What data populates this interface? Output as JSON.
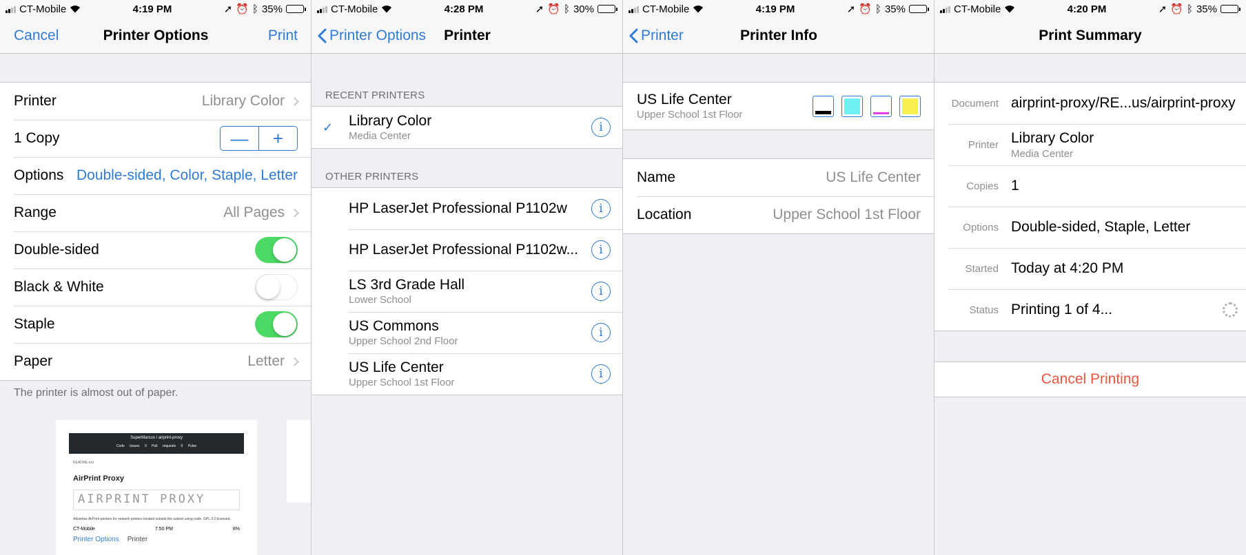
{
  "status_bars": [
    {
      "carrier": "CT-Mobile",
      "time": "4:19 PM",
      "battery": "35%",
      "battery_level": 0.35
    },
    {
      "carrier": "CT-Mobile",
      "time": "4:28 PM",
      "battery": "30%",
      "battery_level": 0.3
    },
    {
      "carrier": "CT-Mobile",
      "time": "4:19 PM",
      "battery": "35%",
      "battery_level": 0.35
    },
    {
      "carrier": "CT-Mobile",
      "time": "4:20 PM",
      "battery": "35%",
      "battery_level": 0.35
    }
  ],
  "screen1": {
    "nav": {
      "left": "Cancel",
      "title": "Printer Options",
      "right": "Print"
    },
    "rows": {
      "printer_label": "Printer",
      "printer_value": "Library Color",
      "copy_label": "1 Copy",
      "stepper_minus": "—",
      "stepper_plus": "+",
      "options_label": "Options",
      "options_value": "Double-sided, Color, Staple, Letter",
      "range_label": "Range",
      "range_value": "All Pages",
      "double_sided_label": "Double-sided",
      "double_sided_on": true,
      "bw_label": "Black & White",
      "bw_on": false,
      "staple_label": "Staple",
      "staple_on": true,
      "paper_label": "Paper",
      "paper_value": "Letter"
    },
    "footnote": "The printer is almost out of paper.",
    "preview": {
      "repo": "SuperMarcus / airprint-proxy",
      "tabs": "Code Issues 0 Pull requests 0 Pulse",
      "readme": "README.md",
      "title": "AirPrint Proxy",
      "logo": "AIRPRINT PROXY",
      "desc": "Advertise AirPrint printers for network printers located outside the subnet using node. GPL-3.0 licensed.",
      "mini_carrier": "CT-Mobile",
      "mini_time": "7:50 PM",
      "mini_battery": "8%",
      "mini_back": "Printer Options",
      "mini_title": "Printer"
    }
  },
  "screen2": {
    "nav": {
      "back": "Printer Options",
      "title": "Printer"
    },
    "recent_header": "RECENT PRINTERS",
    "recent": [
      {
        "name": "Library Color",
        "sub": "Media Center",
        "selected": true
      }
    ],
    "other_header": "OTHER PRINTERS",
    "others": [
      {
        "name": "HP LaserJet Professional P1102w",
        "sub": ""
      },
      {
        "name": "HP LaserJet Professional P1102w...",
        "sub": ""
      },
      {
        "name": "LS 3rd Grade Hall",
        "sub": "Lower School"
      },
      {
        "name": "US Commons",
        "sub": "Upper School 2nd Floor"
      },
      {
        "name": "US Life Center",
        "sub": "Upper School 1st Floor"
      }
    ],
    "check_glyph": "✓",
    "info_glyph": "i"
  },
  "screen3": {
    "nav": {
      "back": "Printer",
      "title": "Printer Info"
    },
    "printer_name": "US Life Center",
    "printer_sub": "Upper School 1st Floor",
    "ink": [
      {
        "color": "#000000",
        "level": 0.2
      },
      {
        "color": "#6ff0f3",
        "level": 1.0
      },
      {
        "color": "#e040e0",
        "level": 0.12
      },
      {
        "color": "#f7ee4f",
        "level": 1.0
      }
    ],
    "name_label": "Name",
    "name_value": "US Life Center",
    "location_label": "Location",
    "location_value": "Upper School 1st Floor"
  },
  "screen4": {
    "nav": {
      "title": "Print Summary"
    },
    "document_label": "Document",
    "document_value": "airprint-proxy/RE...us/airprint-proxy",
    "printer_label": "Printer",
    "printer_value": "Library Color",
    "printer_sub": "Media Center",
    "copies_label": "Copies",
    "copies_value": "1",
    "options_label": "Options",
    "options_value": "Double-sided, Staple, Letter",
    "started_label": "Started",
    "started_value": "Today at 4:20 PM",
    "status_label": "Status",
    "status_value": "Printing 1 of 4...",
    "cancel_label": "Cancel Printing"
  },
  "colors": {
    "accent": "#2e7ad6",
    "toggle_on": "#4cd964",
    "destructive": "#e9563f"
  }
}
